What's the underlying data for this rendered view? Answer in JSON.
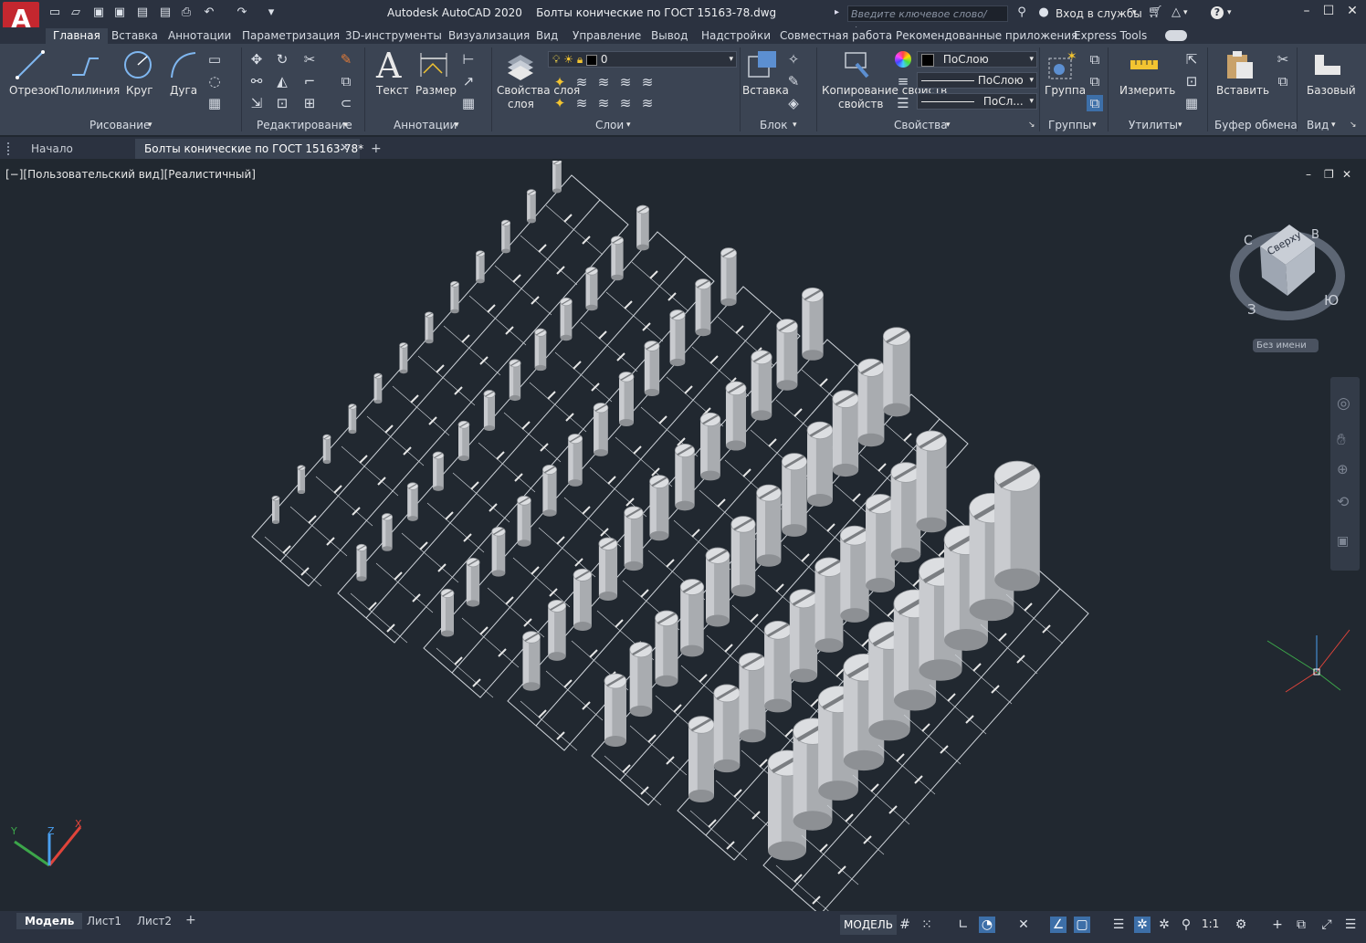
{
  "app": {
    "logo_letter": "A",
    "title": "Autodesk AutoCAD 2020    Болты конические по ГОСТ 15163-78.dwg",
    "search_placeholder": "Введите ключевое слово/фразу",
    "sign_in": "Вход в службы",
    "help": "?"
  },
  "ribbon_tabs": [
    "Главная",
    "Вставка",
    "Аннотации",
    "Параметризация",
    "3D-инструменты",
    "Визуализация",
    "Вид",
    "Управление",
    "Вывод",
    "Надстройки",
    "Совместная работа",
    "Рекомендованные приложения",
    "Express Tools"
  ],
  "active_tab": "Главная",
  "panels": {
    "draw": {
      "title": "Рисование",
      "tools": [
        "Отрезок",
        "Полилиния",
        "Круг",
        "Дуга"
      ]
    },
    "modify": {
      "title": "Редактирование"
    },
    "annotation": {
      "title": "Аннотации",
      "tools": [
        "Текст",
        "Размер"
      ]
    },
    "layers": {
      "title": "Слои",
      "tool": "Свойства слоя",
      "current_layer": "0"
    },
    "block": {
      "title": "Блок",
      "tool": "Вставка"
    },
    "properties": {
      "title": "Свойства",
      "tool": "Копирование свойств",
      "color": "ПоСлою",
      "linetype": "ПоСлою",
      "lineweight": "ПоСл..."
    },
    "groups": {
      "title": "Группы",
      "tool": "Группа"
    },
    "utilities": {
      "title": "Утилиты",
      "tool": "Измерить"
    },
    "clipboard": {
      "title": "Буфер обмена",
      "tool": "Вставить"
    },
    "view": {
      "title": "Вид",
      "tool": "Базовый"
    }
  },
  "doc_tabs": [
    "Начало",
    "Болты конические по ГОСТ 15163-78*"
  ],
  "viewport": {
    "label": "[−][Пользовательский вид][Реалистичный]",
    "viewcube": {
      "face": "Сверху",
      "n": "С",
      "e": "В",
      "s": "Ю",
      "w": "З",
      "named_view": "Без имени"
    },
    "ucs": {
      "x": "X",
      "y": "Y",
      "z": "Z"
    }
  },
  "layout_tabs": [
    "Модель",
    "Лист1",
    "Лист2"
  ],
  "status": {
    "space": "МОДЕЛЬ",
    "scale": "1:1"
  },
  "colors": {
    "bg": "#212830",
    "ribbon": "#3b4453",
    "titlebar": "#2b3240",
    "accent": "#3d6fa8",
    "logo": "#c4272f"
  }
}
